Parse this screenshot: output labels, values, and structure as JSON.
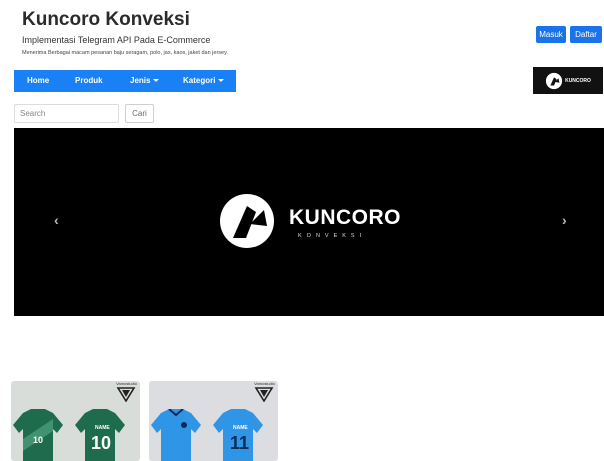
{
  "header": {
    "title": "Kuncoro Konveksi",
    "subtitle": "Implementasi Telegram API Pada E-Commerce",
    "description": "Menerima Berbagai macam pesanan baju seragam, polo, jas, kaos, jaket dan jersey."
  },
  "auth": {
    "login_label": "Masuk",
    "register_label": "Daftar"
  },
  "nav": {
    "items": [
      {
        "label": "Home"
      },
      {
        "label": "Produk"
      },
      {
        "label": "Jenis"
      },
      {
        "label": "Kategori"
      }
    ],
    "logo_text": "KUNCORO"
  },
  "search": {
    "placeholder": "Search",
    "button_label": "Cari"
  },
  "carousel": {
    "brand": "KUNCORO",
    "sub": "KONVEKSI",
    "prev_glyph": "‹",
    "next_glyph": "›"
  },
  "products": [
    {
      "watermark": "Vamostudio",
      "name_text": "NAME",
      "number": "10",
      "color": "#1f6b4d"
    },
    {
      "watermark": "Vamostudio",
      "name_text": "NAME",
      "number": "11",
      "color": "#2f95e6"
    }
  ],
  "colors": {
    "accent": "#1a80f5",
    "button": "#1a73e8"
  }
}
